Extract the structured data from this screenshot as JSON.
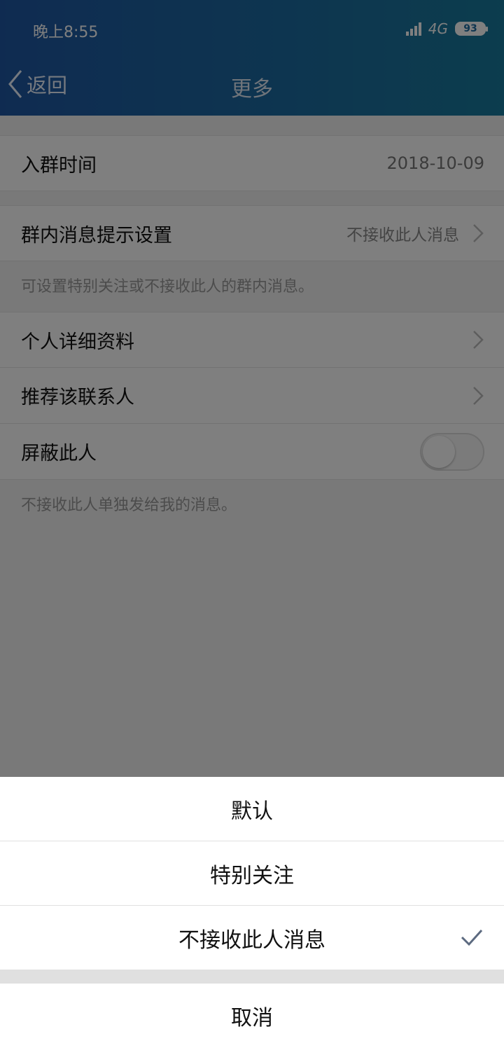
{
  "status_bar": {
    "time": "晚上8:55",
    "network": "4G",
    "battery": "93"
  },
  "nav": {
    "back_label": "返回",
    "title": "更多"
  },
  "rows": {
    "join_time": {
      "label": "入群时间",
      "value": "2018-10-09"
    },
    "group_msg": {
      "label": "群内消息提示设置",
      "value": "不接收此人消息"
    },
    "group_msg_hint": "可设置特别关注或不接收此人的群内消息。",
    "profile": {
      "label": "个人详细资料"
    },
    "recommend": {
      "label": "推荐该联系人"
    },
    "block": {
      "label": "屏蔽此人",
      "enabled": false
    },
    "block_hint": "不接收此人单独发给我的消息。"
  },
  "action_sheet": {
    "options": [
      {
        "label": "默认",
        "selected": false
      },
      {
        "label": "特别关注",
        "selected": false
      },
      {
        "label": "不接收此人消息",
        "selected": true
      }
    ],
    "cancel_label": "取消"
  },
  "colors": {
    "header_start": "#1f57a3",
    "header_end": "#197a9c",
    "check": "#5c6a80"
  }
}
